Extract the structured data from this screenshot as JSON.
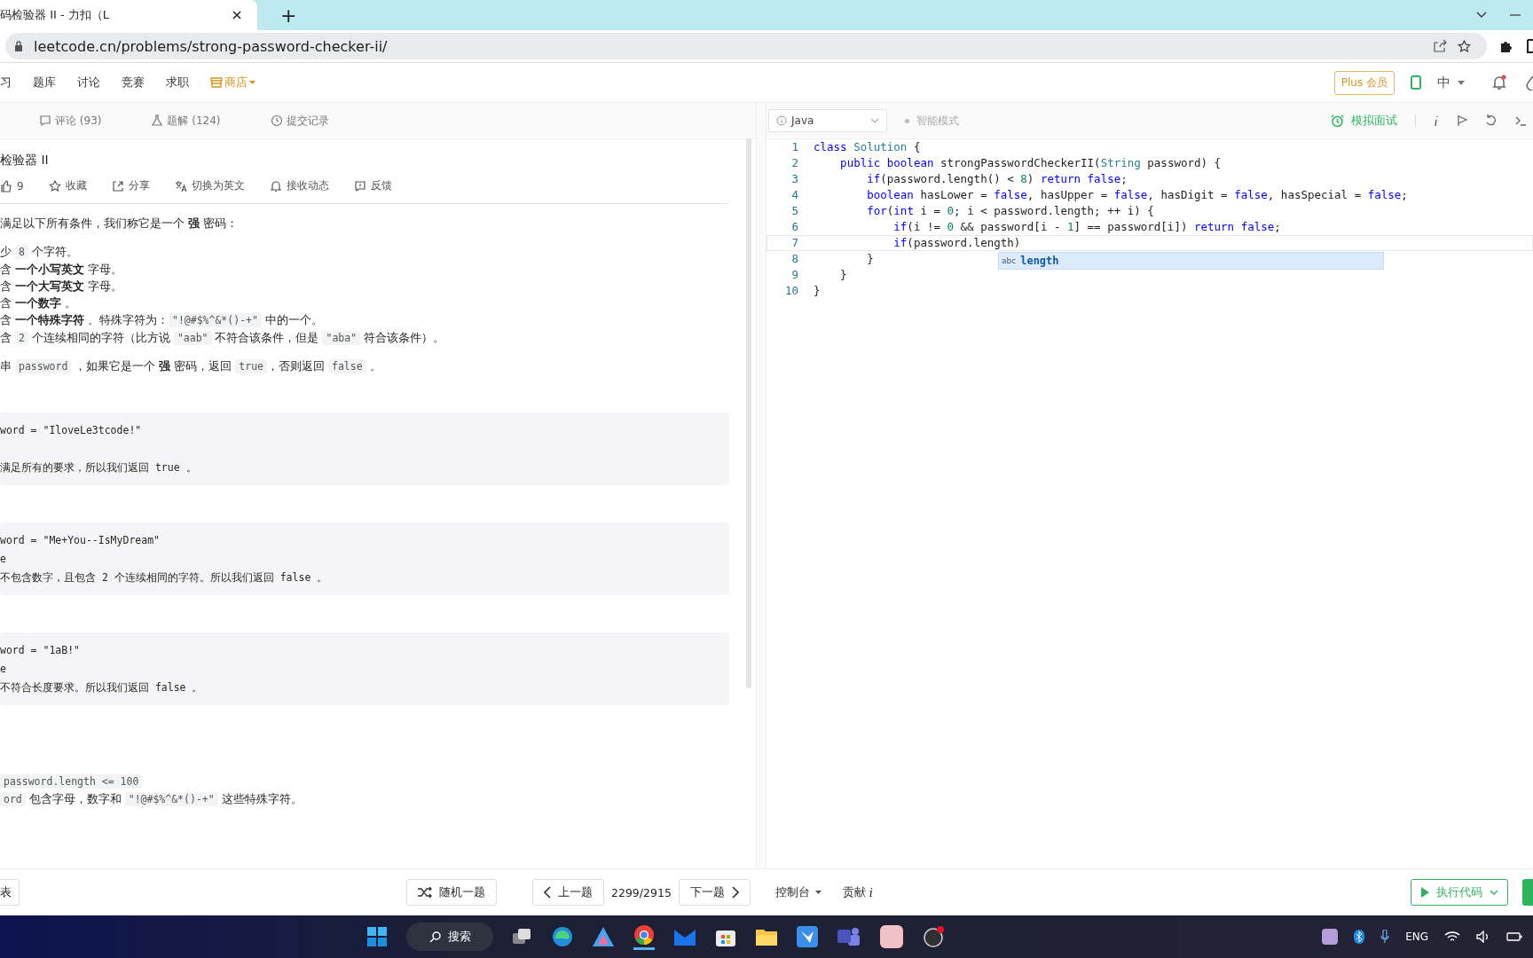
{
  "browser": {
    "tab_title": "码检验器 II - 力扣（L",
    "new_tab": "+",
    "url": "leetcode.cn/problems/strong-password-checker-ii/"
  },
  "nav": {
    "items": [
      "习",
      "题库",
      "讨论",
      "竞赛",
      "求职"
    ],
    "shop": "商店",
    "plus": "Plus 会员",
    "language": "中"
  },
  "left_tabs": [
    {
      "kind": "comment",
      "label": "评论 (93)"
    },
    {
      "kind": "flask",
      "label": "题解 (124)"
    },
    {
      "kind": "clock",
      "label": "提交记录"
    }
  ],
  "problem": {
    "title": "检验器 II",
    "actions": [
      {
        "kind": "like",
        "label": "9"
      },
      {
        "kind": "star",
        "label": "收藏"
      },
      {
        "kind": "share",
        "label": "分享"
      },
      {
        "kind": "translate",
        "label": "切换为英文"
      },
      {
        "kind": "bell",
        "label": "接收动态"
      },
      {
        "kind": "feedback",
        "label": "反馈"
      }
    ],
    "intro": [
      {
        "kind": "text",
        "text": "满足以下所有条件，我们称它是一个 "
      },
      {
        "kind": "bold",
        "text": "强"
      },
      {
        "kind": "text",
        "text": " 密码："
      }
    ],
    "rules": [
      [
        {
          "kind": "text",
          "text": "少 "
        },
        {
          "kind": "code",
          "text": "8"
        },
        {
          "kind": "text",
          "text": " 个字符。"
        }
      ],
      [
        {
          "kind": "text",
          "text": "含 "
        },
        {
          "kind": "bold",
          "text": "一个小写英文"
        },
        {
          "kind": "text",
          "text": " 字母。"
        }
      ],
      [
        {
          "kind": "text",
          "text": "含 "
        },
        {
          "kind": "bold",
          "text": "一个大写英文"
        },
        {
          "kind": "text",
          "text": " 字母。"
        }
      ],
      [
        {
          "kind": "text",
          "text": "含 "
        },
        {
          "kind": "bold",
          "text": "一个数字"
        },
        {
          "kind": "text",
          "text": " 。"
        }
      ],
      [
        {
          "kind": "text",
          "text": "含 "
        },
        {
          "kind": "bold",
          "text": "一个特殊字符"
        },
        {
          "kind": "text",
          "text": " 。特殊字符为："
        },
        {
          "kind": "code",
          "text": "\"!@#$%^&*()-+\""
        },
        {
          "kind": "text",
          "text": " 中的一个。"
        }
      ],
      [
        {
          "kind": "text",
          "text": "含 "
        },
        {
          "kind": "code",
          "text": "2"
        },
        {
          "kind": "text",
          "text": " 个连续相同的字符（比方说 "
        },
        {
          "kind": "code",
          "text": "\"aab\""
        },
        {
          "kind": "text",
          "text": " 不符合该条件，但是 "
        },
        {
          "kind": "code",
          "text": "\"aba\""
        },
        {
          "kind": "text",
          "text": " 符合该条件）。"
        }
      ]
    ],
    "task": [
      {
        "kind": "text",
        "text": "串 "
      },
      {
        "kind": "code",
        "text": "password"
      },
      {
        "kind": "text",
        "text": " ，如果它是一个 "
      },
      {
        "kind": "bold",
        "text": "强"
      },
      {
        "kind": "text",
        "text": " 密码，返回 "
      },
      {
        "kind": "code",
        "text": "true"
      },
      {
        "kind": "text",
        "text": "，否则返回 "
      },
      {
        "kind": "code",
        "text": "false"
      },
      {
        "kind": "text",
        "text": " 。"
      }
    ],
    "examples": [
      {
        "lines": [
          "word = \"IloveLe3tcode!\"",
          "满足所有的要求，所以我们返回 true 。"
        ]
      },
      {
        "lines": [
          "word = \"Me+You--IsMyDream\"",
          "e",
          "不包含数字，且包含 2 个连续相同的字符。所以我们返回 false 。"
        ]
      },
      {
        "lines": [
          "word = \"1aB!\"",
          "e",
          "不符合长度要求。所以我们返回 false 。"
        ]
      }
    ],
    "constraints": [
      [
        {
          "kind": "code",
          "text": "password.length <= 100"
        }
      ],
      [
        {
          "kind": "code",
          "text": "ord"
        },
        {
          "kind": "text",
          "text": " 包含字母，数字和 "
        },
        {
          "kind": "code",
          "text": "\"!@#$%^&*()-+\""
        },
        {
          "kind": "text",
          "text": " 这些特殊字符。"
        }
      ]
    ]
  },
  "editor": {
    "language": "Java",
    "mode": "智能模式",
    "interview": "模拟面试",
    "lines": [
      {
        "number": "1",
        "current": false,
        "tokens": [
          {
            "kind": "keyword",
            "text": "class"
          },
          {
            "kind": "type",
            "text": " Solution"
          },
          {
            "kind": "plain",
            "text": " {"
          }
        ]
      },
      {
        "number": "2",
        "current": false,
        "tokens": [
          {
            "kind": "keyword",
            "text": "    public"
          },
          {
            "kind": "keyword",
            "text": " boolean"
          },
          {
            "kind": "plain",
            "text": " strongPasswordCheckerII("
          },
          {
            "kind": "type",
            "text": "String"
          },
          {
            "kind": "plain",
            "text": " password) {"
          }
        ]
      },
      {
        "number": "3",
        "current": false,
        "tokens": [
          {
            "kind": "keyword",
            "text": "        if"
          },
          {
            "kind": "plain",
            "text": "(password.length() < "
          },
          {
            "kind": "number",
            "text": "8"
          },
          {
            "kind": "plain",
            "text": ") "
          },
          {
            "kind": "keyword",
            "text": "return"
          },
          {
            "kind": "keyword",
            "text": " false"
          },
          {
            "kind": "plain",
            "text": ";"
          }
        ]
      },
      {
        "number": "4",
        "current": false,
        "tokens": [
          {
            "kind": "keyword",
            "text": "        boolean"
          },
          {
            "kind": "plain",
            "text": " hasLower = "
          },
          {
            "kind": "keyword",
            "text": "false"
          },
          {
            "kind": "plain",
            "text": ", hasUpper = "
          },
          {
            "kind": "keyword",
            "text": "false"
          },
          {
            "kind": "plain",
            "text": ", hasDigit = "
          },
          {
            "kind": "keyword",
            "text": "false"
          },
          {
            "kind": "plain",
            "text": ", hasSpecial = "
          },
          {
            "kind": "keyword",
            "text": "false"
          },
          {
            "kind": "plain",
            "text": ";"
          }
        ]
      },
      {
        "number": "5",
        "current": false,
        "tokens": [
          {
            "kind": "keyword",
            "text": "        for"
          },
          {
            "kind": "plain",
            "text": "("
          },
          {
            "kind": "keyword",
            "text": "int"
          },
          {
            "kind": "plain",
            "text": " i = "
          },
          {
            "kind": "number",
            "text": "0"
          },
          {
            "kind": "plain",
            "text": "; i < password.length; ++ i) {"
          }
        ]
      },
      {
        "number": "6",
        "current": false,
        "tokens": [
          {
            "kind": "keyword",
            "text": "            if"
          },
          {
            "kind": "plain",
            "text": "(i != "
          },
          {
            "kind": "number",
            "text": "0"
          },
          {
            "kind": "plain",
            "text": " && password[i - "
          },
          {
            "kind": "number",
            "text": "1"
          },
          {
            "kind": "plain",
            "text": "] == password[i]) "
          },
          {
            "kind": "keyword",
            "text": "return"
          },
          {
            "kind": "keyword",
            "text": " false"
          },
          {
            "kind": "plain",
            "text": ";"
          }
        ]
      },
      {
        "number": "7",
        "current": true,
        "tokens": [
          {
            "kind": "keyword",
            "text": "            if"
          },
          {
            "kind": "plain",
            "text": "(password.length)"
          }
        ]
      },
      {
        "number": "8",
        "current": false,
        "tokens": [
          {
            "kind": "plain",
            "text": "        }"
          }
        ]
      },
      {
        "number": "9",
        "current": false,
        "tokens": [
          {
            "kind": "plain",
            "text": "    }"
          }
        ]
      },
      {
        "number": "10",
        "current": false,
        "tokens": [
          {
            "kind": "plain",
            "text": "}"
          }
        ]
      }
    ],
    "autocomplete": {
      "tag": "abc",
      "label": "length"
    }
  },
  "bottom": {
    "left_button": "表",
    "random": "随机一题",
    "prev": "上一题",
    "counter": "2299/2915",
    "next": "下一题",
    "console": "控制台",
    "contribute": "贡献",
    "info": "i",
    "run": "执行代码"
  },
  "taskbar": {
    "search": "搜索",
    "input_language": "ENG"
  }
}
